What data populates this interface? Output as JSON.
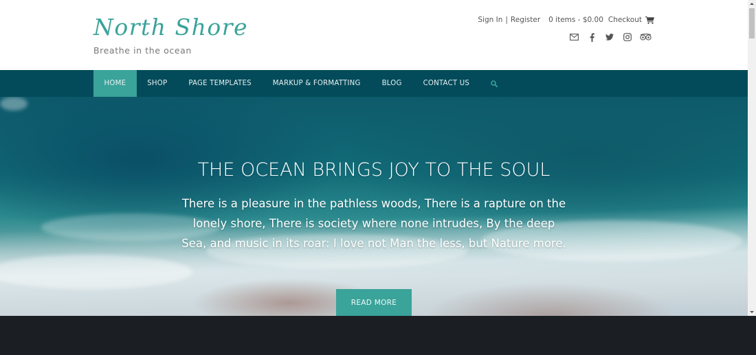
{
  "site": {
    "title": "North Shore",
    "tagline": "Breathe in the ocean"
  },
  "account": {
    "sign_in": "Sign In",
    "separator": "|",
    "register": "Register",
    "cart_summary": "0 items - $0.00",
    "checkout": "Checkout",
    "cart_icon": "shopping-cart-icon"
  },
  "social": [
    {
      "name": "email",
      "icon": "envelope-icon"
    },
    {
      "name": "facebook",
      "icon": "facebook-icon"
    },
    {
      "name": "twitter",
      "icon": "twitter-icon"
    },
    {
      "name": "instagram",
      "icon": "instagram-icon"
    },
    {
      "name": "tripadvisor",
      "icon": "tripadvisor-icon"
    }
  ],
  "nav": {
    "items": [
      {
        "label": "HOME",
        "active": true
      },
      {
        "label": "SHOP",
        "active": false
      },
      {
        "label": "PAGE TEMPLATES",
        "active": false
      },
      {
        "label": "MARKUP & FORMATTING",
        "active": false
      },
      {
        "label": "BLOG",
        "active": false
      },
      {
        "label": "CONTACT US",
        "active": false
      }
    ],
    "search_icon": "search-icon"
  },
  "hero": {
    "title": "THE OCEAN BRINGS JOY TO THE SOUL",
    "text": "There is a pleasure in the pathless woods, There is a rapture on the lonely shore, There is society where none intrudes, By the deep Sea, and music in its roar: I love not Man the less, but Nature more.",
    "button": "READ MORE"
  },
  "colors": {
    "accent": "#3aa39a",
    "nav_bg": "#034b5a",
    "footer_bg": "#1b1f23",
    "text_muted": "#777777"
  }
}
